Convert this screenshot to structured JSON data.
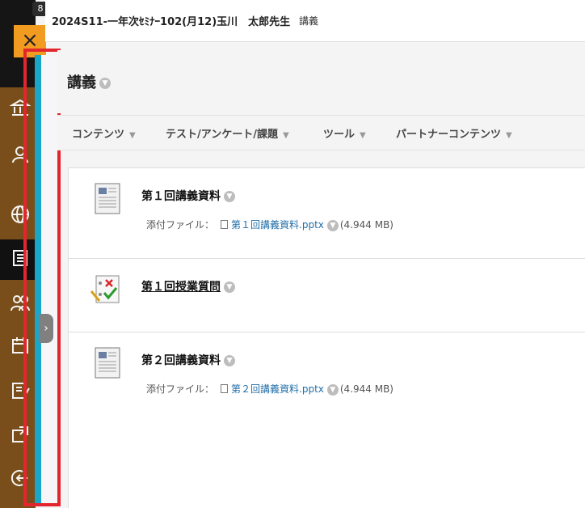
{
  "header": {
    "course_title": "2024S11-一年次ｾﾐﾅｰ102(月12)玉川　太郎先生",
    "breadcrumb": "講義"
  },
  "rail": {
    "badge": "8",
    "close_glyph": "×"
  },
  "page": {
    "title": "講義"
  },
  "action_bar": {
    "items": [
      {
        "label": "コンテンツ"
      },
      {
        "label": "テスト/アンケート/課題"
      },
      {
        "label": "ツール"
      },
      {
        "label": "パートナーコンテンツ"
      }
    ]
  },
  "content": {
    "items": [
      {
        "title": "第１回講義資料",
        "attachment_label": "添付ファイル：",
        "file_name": "第１回講義資料.pptx",
        "file_size": "(4.944 MB)"
      },
      {
        "title": "第１回授業質問"
      },
      {
        "title": "第２回講義資料",
        "attachment_label": "添付ファイル：",
        "file_name": "第２回講義資料.pptx",
        "file_size": "(4.944 MB)"
      }
    ]
  },
  "colors": {
    "rail_brown": "#7a4e1a",
    "close_orange": "#f29b21",
    "highlight_red": "#e3262d",
    "strip_teal": "#1aa6c8",
    "link_blue": "#1f6ea8"
  }
}
